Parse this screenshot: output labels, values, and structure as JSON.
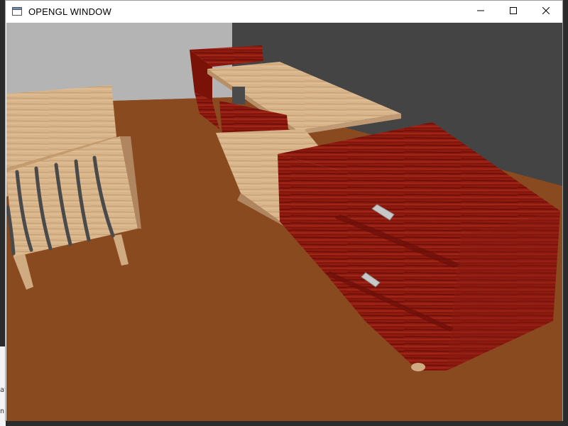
{
  "window": {
    "title": "OPENGL WINDOW",
    "icon": "window-app-icon"
  },
  "title_bar_controls": {
    "minimize": "minimize-icon",
    "maximize": "maximize-icon",
    "close": "close-icon"
  },
  "console_fragments": [
    "av",
    "n"
  ],
  "scene": {
    "colors": {
      "floor": "#8a4a20",
      "wall_left": "#b4b4b4",
      "wall_right": "#444444",
      "light_wood": "#d8b48a",
      "dark_wood": "#8e1a10",
      "metal": "#4a4a4a",
      "handle": "#c8c8c8"
    }
  }
}
